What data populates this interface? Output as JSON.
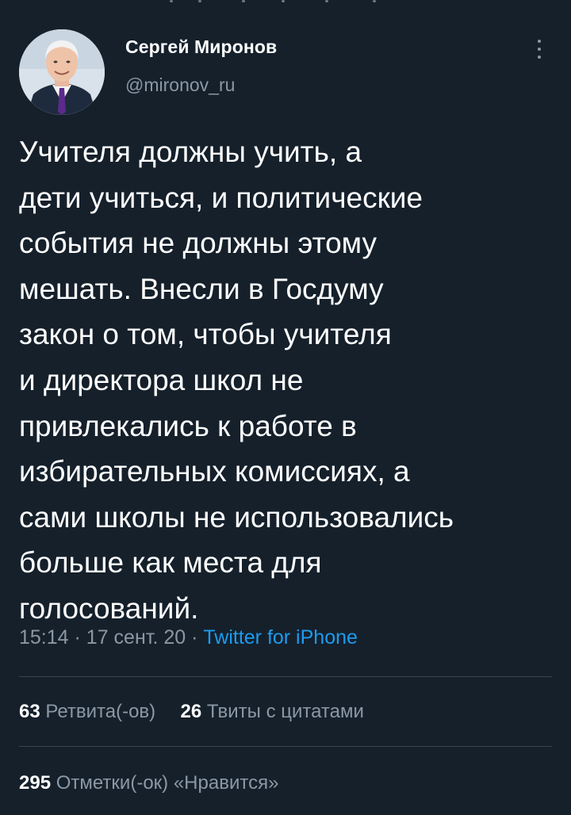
{
  "author": {
    "display_name": "Сергей Миронов",
    "handle": "@mironov_ru",
    "avatar_icon": "profile-photo"
  },
  "tweet": {
    "text": "Учителя должны учить, а\nдети учиться, и политические\nсобытия не должны этому\nмешать. Внесли в Госдуму\nзакон о том, чтобы учителя\nи директора школ не\nпривлекались к работе в\nизбирательных комиссиях, а\nсами школы не использовались\nбольше  как места для\nголосований.",
    "time": "15:14",
    "date": "17 сент. 20",
    "separator": "·",
    "source": "Twitter for iPhone"
  },
  "stats": {
    "retweets_count": "63",
    "retweets_label": "Ретвита(-ов)",
    "quotes_count": "26",
    "quotes_label": "Твиты с цитатами",
    "likes_count": "295",
    "likes_label": "Отметки(-ок) «Нравится»"
  },
  "colors": {
    "background": "#15202b",
    "primary_text": "#ffffff",
    "secondary_text": "#8b98a5",
    "link": "#1d9bf0",
    "divider": "#38444d"
  }
}
